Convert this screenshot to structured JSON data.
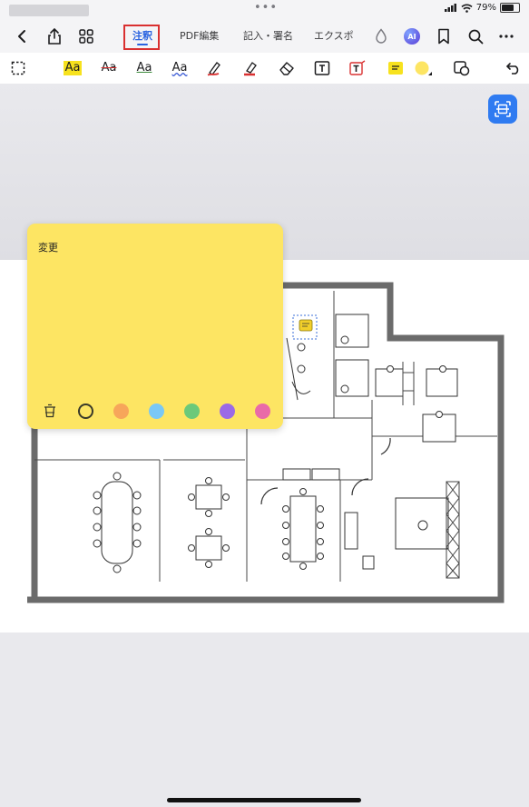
{
  "status": {
    "battery_text": "79%",
    "battery_level": 0.79
  },
  "nav": {
    "tabs": [
      {
        "label": "注釈",
        "active": true
      },
      {
        "label": "PDF編集",
        "active": false
      },
      {
        "label": "記入・署名",
        "active": false
      },
      {
        "label": "エクスポ",
        "active": false
      }
    ],
    "ai_label": "AI",
    "icons": [
      "back-icon",
      "share-icon",
      "grid-icon",
      "droplet-icon",
      "ai-icon",
      "bookmark-icon",
      "search-icon",
      "more-icon"
    ]
  },
  "toolbar": {
    "aa_label": "Aa",
    "tools": [
      "select-area",
      "highlight-text",
      "strikethrough-text",
      "underline-text",
      "squiggly-text",
      "pen",
      "highlighter",
      "eraser",
      "text-box",
      "text-callout",
      "sticky-note",
      "color-picker",
      "shape",
      "undo"
    ],
    "colors": {
      "highlight": "#f7e21e",
      "strike": "#d93030",
      "underline": "#3a8a3a",
      "squiggly": "#3b5bd6",
      "pen": "#d93030",
      "note_color": "#fde563"
    }
  },
  "sticky_note": {
    "text": "変更",
    "color": "#fde563",
    "colors": [
      "#fde563",
      "#f7a65a",
      "#7ac8f5",
      "#6cc97a",
      "#9b6ae6",
      "#e96aa8"
    ]
  },
  "accent": "#2a63e0"
}
